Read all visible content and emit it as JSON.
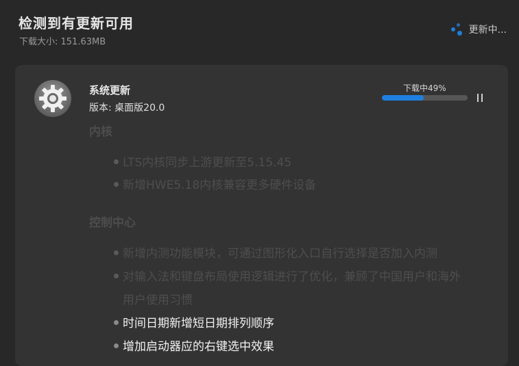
{
  "header": {
    "title": "检测到有更新可用",
    "download_size": "下载大小: 151.63MB",
    "status": "更新中..."
  },
  "package": {
    "name": "系统更新",
    "version": "版本: 桌面版20.0",
    "icon": "gear-icon",
    "progress_label": "下载中49%",
    "progress_fraction": 0.49
  },
  "notes": {
    "kernel": {
      "title": "内核",
      "items": [
        "LTS内核同步上游更新至5.15.45",
        "新增HWE5.18内核兼容更多硬件设备"
      ]
    },
    "control_center": {
      "title": "控制中心",
      "items": [
        "新增内测功能模块，可通过图形化入口自行选择是否加入内测",
        "对输入法和键盘布局使用逻辑进行了优化，兼顾了中国用户和海外",
        "用户使用习惯",
        "时间日期新增短日期排列顺序",
        "增加启动器应的右键选中效果"
      ]
    }
  },
  "colors": {
    "background": "#282828",
    "card": "#333333",
    "accent": "#1f7fe0",
    "faded_text": "#4e4e4e"
  }
}
